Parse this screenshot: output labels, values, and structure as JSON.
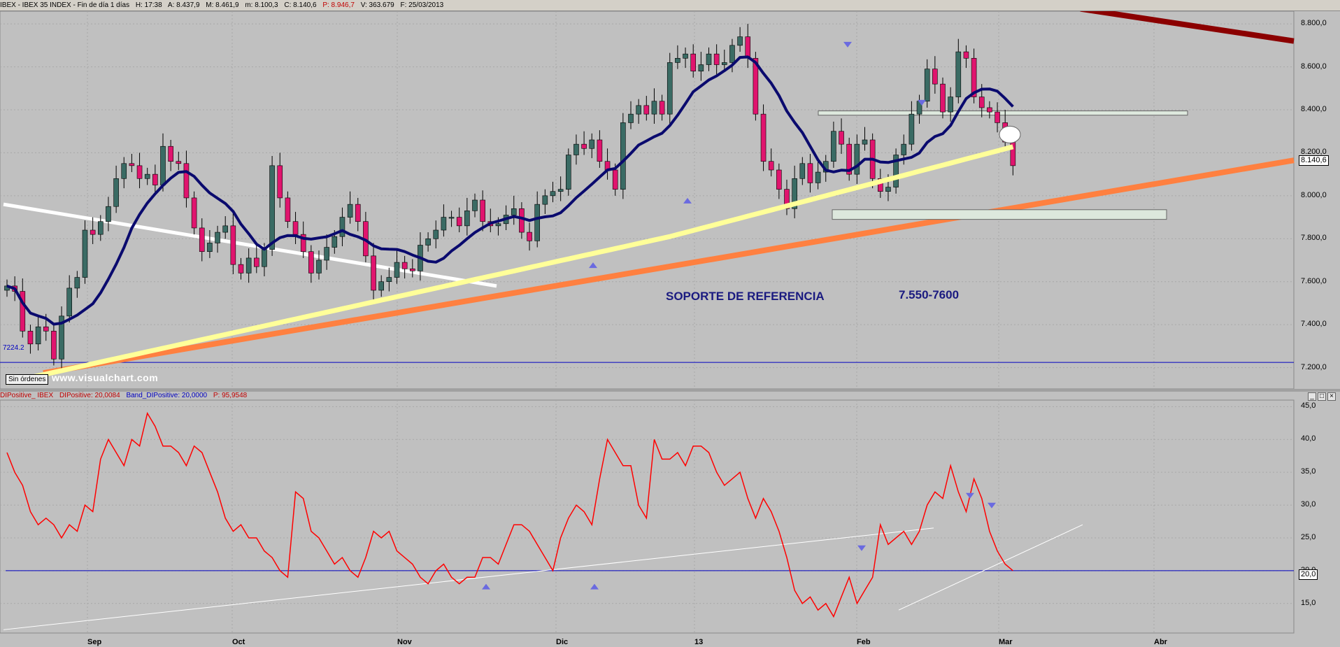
{
  "header": {
    "title": "IBEX - IBEX 35 INDEX - Fin de día 1 días",
    "h": "H: 17:38",
    "a": "A: 8.437,9",
    "m": "M: 8.461,9",
    "mn": "m: 8.100,3",
    "c": "C: 8.140,6",
    "p": "P: 8.946,7",
    "v": "V: 363.679",
    "f": "F: 25/03/2013"
  },
  "indicator_header": {
    "name": "DIPositive_ IBEX",
    "value": "DIPositive: 20,0084",
    "band": "Band_DIPositive: 20,0000",
    "p": "P: 95,9548"
  },
  "labels": {
    "sin_ordenes": "Sin órdenes",
    "watermark": "www.visualchart.com",
    "level_7224": "7224.2",
    "soporte": "SOPORTE DE REFERENCIA",
    "rango": "7.550-7600",
    "last_price": "8.140,6",
    "band_value": "20,0"
  },
  "colors": {
    "background": "#c0c0c0",
    "candle_up": "#3a6b64",
    "candle_down": "#e0146e",
    "ma_fast": "#0a0a6e",
    "ma_slow": "#ffff99",
    "trend_support": "#ff8040",
    "trend_resist": "#8b0000",
    "indicator": "#ff0000",
    "band": "#0000c0"
  },
  "chart_data": [
    {
      "type": "candlestick",
      "title": "IBEX - IBEX 35 INDEX",
      "x_ticks": [
        "Sep",
        "Oct",
        "Nov",
        "Dic",
        "13",
        "Feb",
        "Mar",
        "Abr"
      ],
      "y_ticks": [
        "8.800,0",
        "8.600,0",
        "8.400,0",
        "8.200,0",
        "8.000,0",
        "7.800,0",
        "7.600,0",
        "7.400,0",
        "7.200,0"
      ],
      "ylim": [
        7140,
        8820
      ],
      "grid": true,
      "close": [
        7580,
        7555,
        7370,
        7310,
        7390,
        7370,
        7240,
        7440,
        7570,
        7620,
        7840,
        7820,
        7880,
        7950,
        8080,
        8150,
        8140,
        8080,
        8100,
        8050,
        8230,
        8160,
        8150,
        7990,
        7850,
        7740,
        7780,
        7830,
        7860,
        7680,
        7640,
        7710,
        7670,
        7750,
        8140,
        7990,
        7880,
        7820,
        7740,
        7640,
        7700,
        7760,
        7810,
        7900,
        7960,
        7880,
        7720,
        7560,
        7600,
        7620,
        7690,
        7660,
        7650,
        7770,
        7800,
        7840,
        7900,
        7900,
        7860,
        7930,
        7980,
        7880,
        7860,
        7870,
        7910,
        7940,
        7830,
        7790,
        7960,
        8000,
        8020,
        8030,
        8190,
        8240,
        8220,
        8260,
        8160,
        8120,
        8030,
        8340,
        8380,
        8420,
        8380,
        8440,
        8380,
        8620,
        8640,
        8660,
        8580,
        8610,
        8660,
        8610,
        8620,
        8700,
        8740,
        8640,
        8380,
        8160,
        8120,
        8030,
        7940,
        8080,
        8150,
        8060,
        8110,
        8160,
        8300,
        8240,
        8100,
        8240,
        8260,
        8080,
        8020,
        8040,
        8190,
        8240,
        8380,
        8440,
        8590,
        8520,
        8390,
        8460,
        8670,
        8640,
        8460,
        8410,
        8390,
        8340,
        8250,
        8140
      ],
      "ma_fast_approx": "blue smoothed moving average",
      "ma_slow_approx": "yellow smoothed moving average",
      "support_level": 7224.2,
      "last_price": 8140.6
    },
    {
      "type": "line",
      "title": "DIPositive_ IBEX",
      "y_ticks": [
        "45,0",
        "40,0",
        "35,0",
        "30,0",
        "25,0",
        "20,0",
        "15,0"
      ],
      "ylim": [
        10.5,
        46
      ],
      "band": 20.0,
      "values": [
        38,
        35,
        33,
        29,
        27,
        28,
        27,
        25,
        27,
        26,
        30,
        29,
        37,
        40,
        38,
        36,
        40,
        39,
        44,
        42,
        39,
        39,
        38,
        36,
        39,
        38,
        35,
        32,
        28,
        26,
        27,
        25,
        25,
        23,
        22,
        20,
        19,
        32,
        31,
        26,
        25,
        23,
        21,
        22,
        20,
        19,
        22,
        26,
        25,
        26,
        23,
        22,
        21,
        19,
        18,
        20,
        21,
        19,
        18,
        19,
        19,
        22,
        22,
        21,
        24,
        27,
        27,
        26,
        24,
        22,
        20,
        25,
        28,
        30,
        29,
        27,
        34,
        40,
        38,
        36,
        36,
        30,
        28,
        40,
        37,
        37,
        38,
        36,
        39,
        39,
        38,
        35,
        33,
        34,
        35,
        31,
        28,
        31,
        29,
        26,
        22,
        17,
        15,
        16,
        14,
        15,
        13,
        16,
        19,
        15,
        17,
        19,
        27,
        24,
        25,
        26,
        24,
        26,
        30,
        32,
        31,
        36,
        32,
        29,
        34,
        31,
        26,
        23,
        21,
        20
      ],
      "trend_note": "white diagonal trendlines"
    }
  ]
}
